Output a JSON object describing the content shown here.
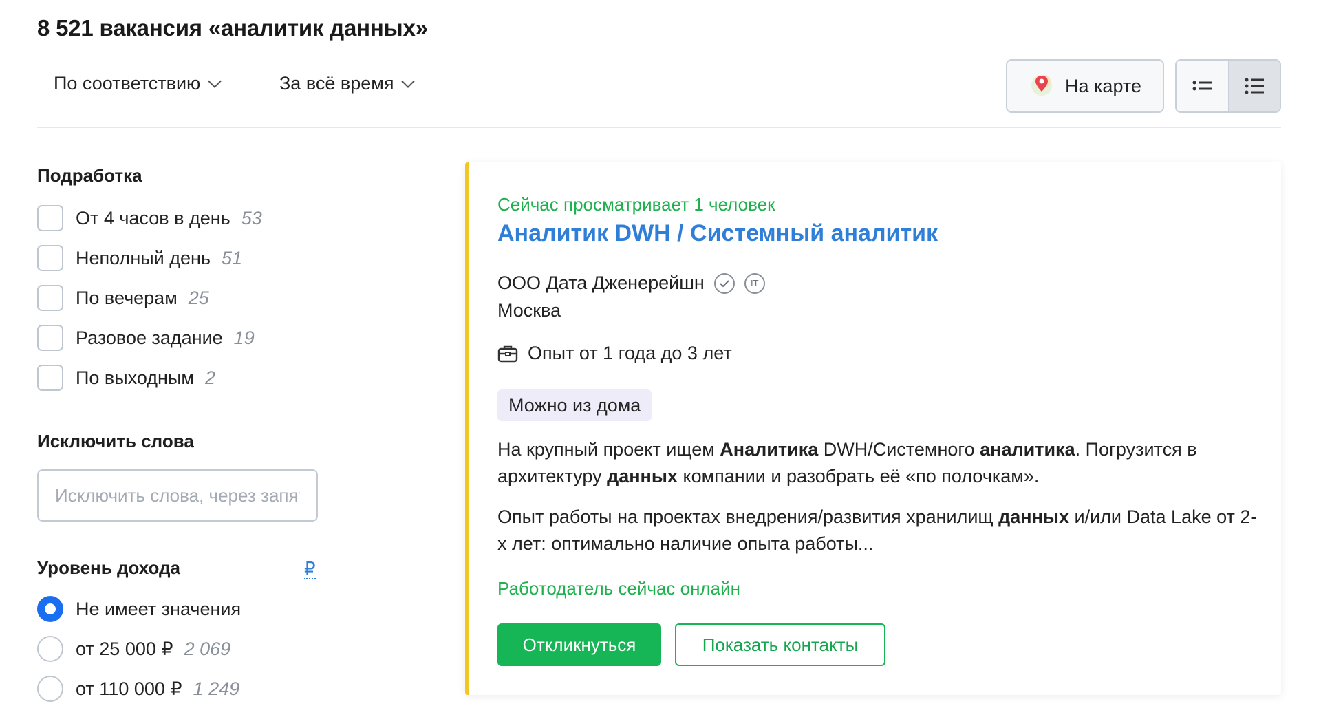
{
  "header": {
    "title": "8 521 вакансия «аналитик данных»",
    "sort_label": "По соответствию",
    "period_label": "За всё время",
    "map_label": "На карте"
  },
  "filters": {
    "parttime": {
      "title": "Подработка",
      "items": [
        {
          "label": "От 4 часов в день",
          "count": "53"
        },
        {
          "label": "Неполный день",
          "count": "51"
        },
        {
          "label": "По вечерам",
          "count": "25"
        },
        {
          "label": "Разовое задание",
          "count": "19"
        },
        {
          "label": "По выходным",
          "count": "2"
        }
      ]
    },
    "exclude": {
      "title": "Исключить слова",
      "placeholder": "Исключить слова, через запятую"
    },
    "income": {
      "title": "Уровень дохода",
      "currency": "₽",
      "options": [
        {
          "label": "Не имеет значения",
          "count": "",
          "checked": true
        },
        {
          "label": "от 25 000 ₽",
          "count": "2 069",
          "checked": false
        },
        {
          "label": "от 110 000 ₽",
          "count": "1 249",
          "checked": false
        }
      ]
    }
  },
  "vacancy": {
    "viewers": "Сейчас просматривает 1 человек",
    "title": "Аналитик DWH / Системный аналитик",
    "company": "ООО Дата Дженерейшн",
    "city": "Москва",
    "experience": "Опыт от 1 года до 3 лет",
    "tag": "Можно из дома",
    "desc1": {
      "a": "На крупный проект ищем ",
      "b": "Аналитика",
      "c": " DWH/Системного ",
      "d": "аналитика",
      "e": ". Погрузится в архитектуру ",
      "f": "данных",
      "g": " компании и разобрать её «по полочкам»."
    },
    "desc2": {
      "a": "Опыт работы на проектах внедрения/развития хранилищ ",
      "b": "данных",
      "c": " и/или Data Lake от 2-х лет: оптимально наличие опыта работы..."
    },
    "online": "Работодатель сейчас онлайн",
    "apply_label": "Откликнуться",
    "contacts_label": "Показать контакты"
  },
  "colors": {
    "accent_blue": "#2f7fd8",
    "green": "#16b556",
    "highlight_border": "#f3c624"
  }
}
